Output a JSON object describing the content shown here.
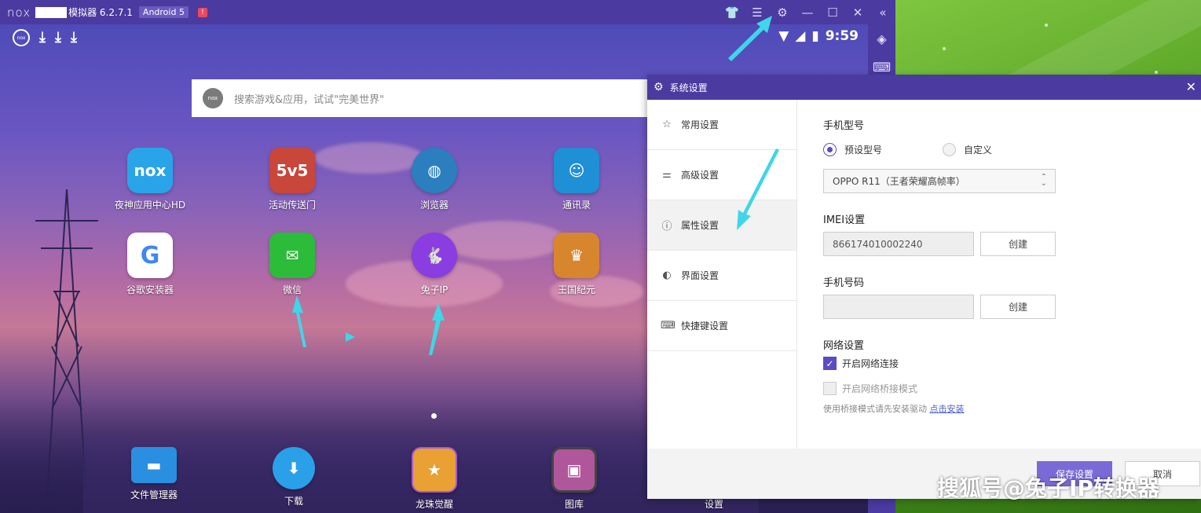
{
  "window": {
    "title": "模拟器 6.2.7.1",
    "android_badge": "Android 5",
    "warning": "!",
    "logo": "nox"
  },
  "statusbar": {
    "time": "9:59",
    "nox_badge": "nox"
  },
  "search": {
    "placeholder": "搜索游戏&应用，试试\"完美世界\"",
    "logo": "nox"
  },
  "apps": [
    {
      "label": "夜神应用中心HD",
      "icon": "nox-appcenter-icon",
      "glyph": "nox",
      "color": "#2aa4e8"
    },
    {
      "label": "活动传送门",
      "icon": "game-hero-icon",
      "glyph": "5v5",
      "color": "#c8463a"
    },
    {
      "label": "浏览器",
      "icon": "globe-icon",
      "glyph": "◍",
      "color": "#2b7fbf"
    },
    {
      "label": "通讯录",
      "icon": "contacts-icon",
      "glyph": "☺",
      "color": "#1f8fd6"
    },
    {
      "label": "谷歌安装器",
      "icon": "google-icon",
      "glyph": "G",
      "color": "#ffffff"
    },
    {
      "label": "微信",
      "icon": "wechat-icon",
      "glyph": "✉",
      "color": "#2dbb3a"
    },
    {
      "label": "兔子IP",
      "icon": "rabbit-icon",
      "glyph": "🐇",
      "color": "#8a3de0"
    },
    {
      "label": "王国纪元",
      "icon": "lordsmobile-icon",
      "glyph": "♛",
      "color": "#d7862e"
    }
  ],
  "dock": [
    {
      "label": "文件管理器",
      "icon": "folder-icon",
      "glyph": "▬",
      "color": "#2a8fe0"
    },
    {
      "label": "下载",
      "icon": "download-icon",
      "glyph": "⬇",
      "color": "#2aa0e8"
    },
    {
      "label": "龙珠觉醒",
      "icon": "dragonball-icon",
      "glyph": "★",
      "color": "#e8a132"
    },
    {
      "label": "图库",
      "icon": "gallery-icon",
      "glyph": "▣",
      "color": "#b0579c"
    },
    {
      "label": "设置",
      "icon": "settings-icon",
      "glyph": "⚙",
      "color": "#4b3aa0"
    }
  ],
  "dialog": {
    "title": "系统设置",
    "nav": [
      "常用设置",
      "高级设置",
      "属性设置",
      "界面设置",
      "快捷键设置"
    ],
    "phone_model": {
      "title": "手机型号",
      "preset_label": "预设型号",
      "custom_label": "自定义",
      "selected": "OPPO R11（王者荣耀高帧率）"
    },
    "imei": {
      "title": "IMEI设置",
      "value": "866174010002240",
      "create": "创建"
    },
    "phone_number": {
      "title": "手机号码",
      "value": "",
      "create": "创建"
    },
    "network": {
      "title": "网络设置",
      "enable_label": "开启网络连接",
      "bridge_label": "开启网络桥接模式",
      "hint": "使用桥接模式请先安装驱动",
      "install_link": "点击安装"
    },
    "save": "保存设置",
    "cancel": "取消"
  },
  "watermark": "搜狐号@兔子IP转换器"
}
